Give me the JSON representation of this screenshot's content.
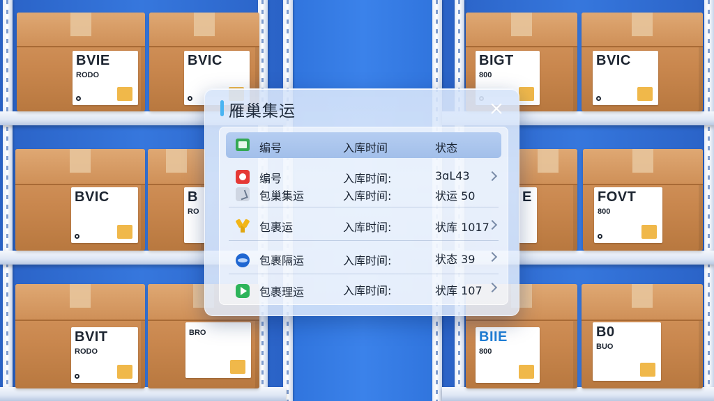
{
  "dialog": {
    "title": "雁巢集运",
    "close_icon": "close-icon"
  },
  "table": {
    "headers": [
      "编号",
      "入库时间",
      "状态"
    ],
    "rows": [
      {
        "icon": "red-app-icon",
        "lines": [
          {
            "id": "编号",
            "time": "入库时间:",
            "status": "3ɑL43"
          },
          {
            "id": "包巢集运",
            "time": "入库时间:",
            "status": "状运 50"
          }
        ],
        "second_icon": "gray-check-icon"
      },
      {
        "icon": "yellow-y-icon",
        "id": "包裹运",
        "time": "入库时间:",
        "status": "状库 1017"
      },
      {
        "icon": "blue-globe-icon",
        "id": "包裹隔运",
        "time": "入库时间:",
        "status": "状态 39"
      },
      {
        "icon": "green-play-icon",
        "id": "包裹理运",
        "time": "入库时间:",
        "status": "状库 107"
      }
    ]
  },
  "boxes": [
    {
      "brand": "BVIE",
      "sub": "RODO"
    },
    {
      "brand": "BVIC",
      "sub": ""
    },
    {
      "brand": "BIGT",
      "sub": "800"
    },
    {
      "brand": "BVIC",
      "sub": ""
    },
    {
      "brand": "BVIC",
      "sub": ""
    },
    {
      "brand": "B",
      "sub": "RO"
    },
    {
      "brand": "E",
      "sub": ""
    },
    {
      "brand": "FOVT",
      "sub": "800"
    },
    {
      "brand": "BVIT",
      "sub": "RODO"
    },
    {
      "brand": "",
      "sub": "BRO"
    },
    {
      "brand": "BIIE",
      "sub": "800"
    },
    {
      "brand": "B0",
      "sub": "BUO"
    }
  ],
  "colors": {
    "accent": "#49b4f2",
    "header_bg": "#a9c4ed",
    "background": "#2f6fd6"
  }
}
